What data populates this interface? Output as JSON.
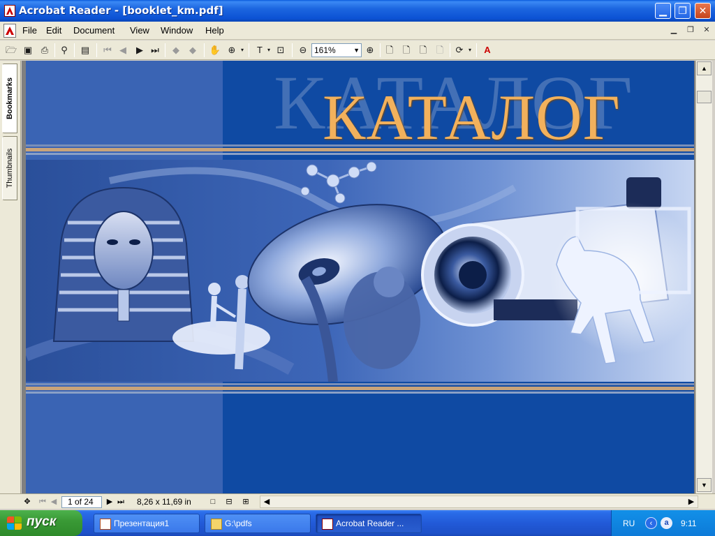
{
  "window": {
    "title": "Acrobat Reader - [booklet_km.pdf]"
  },
  "menu": {
    "items": [
      "File",
      "Edit",
      "Document",
      "View",
      "Window",
      "Help"
    ]
  },
  "toolbar": {
    "zoom_value": "161%"
  },
  "sidebar": {
    "tabs": [
      "Bookmarks",
      "Thumbnails"
    ]
  },
  "document": {
    "heading": "КАТАЛОГ",
    "colors": {
      "page_blue": "#0f4aa3",
      "left_band": "#3a64b4",
      "title_gold": "#f2b15c",
      "stripe_tan": "#c9a47a"
    }
  },
  "statusbar": {
    "page_indicator": "1 of 24",
    "page_size": "8,26 x 11,69 in"
  },
  "taskbar": {
    "start_label": "пуск",
    "tasks": [
      "Презентация1",
      "G:\\pdfs",
      "Acrobat Reader ..."
    ],
    "tray": {
      "language": "RU",
      "clock": "9:11"
    }
  }
}
